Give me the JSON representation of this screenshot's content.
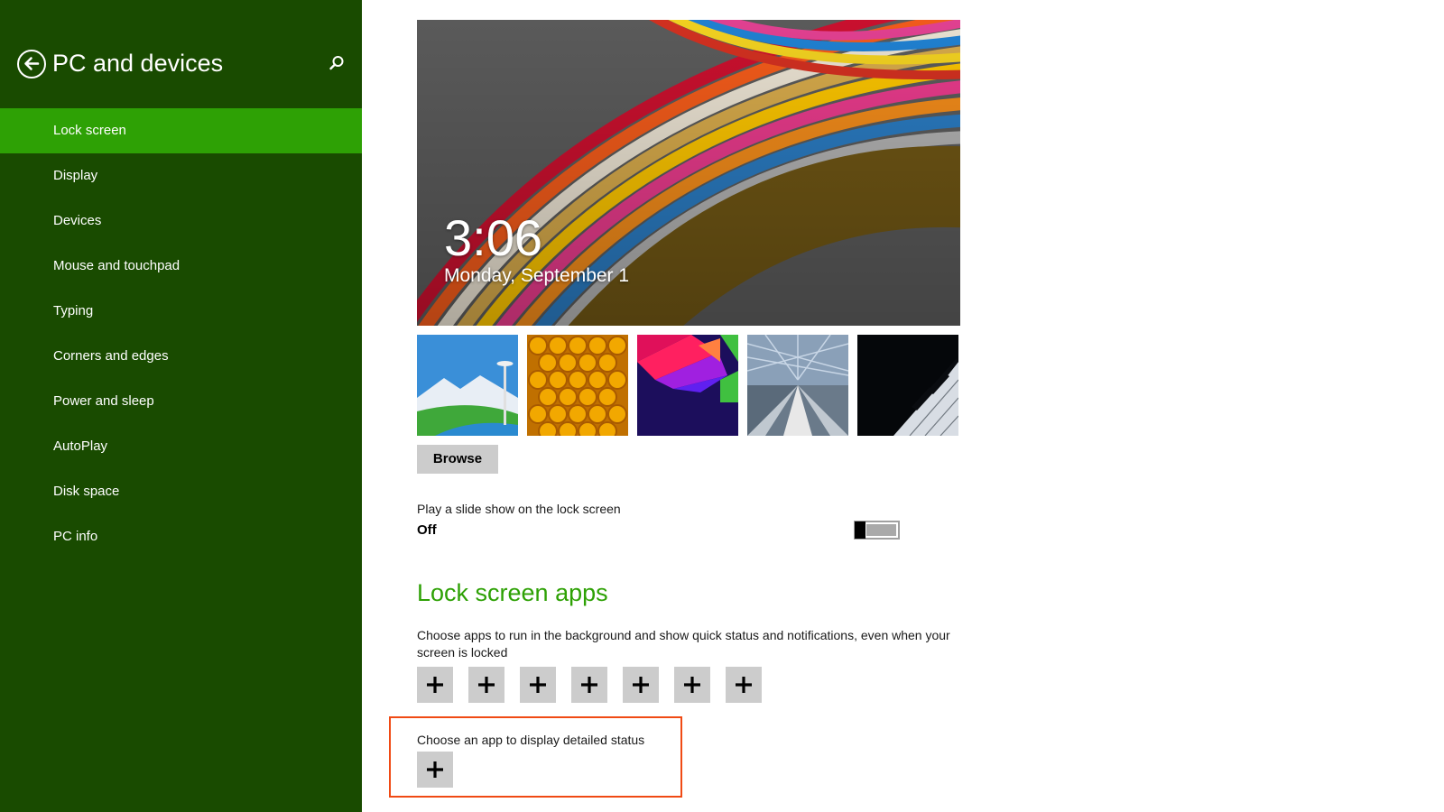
{
  "sidebar": {
    "title": "PC and devices",
    "items": [
      {
        "label": "Lock screen",
        "active": true
      },
      {
        "label": "Display"
      },
      {
        "label": "Devices"
      },
      {
        "label": "Mouse and touchpad"
      },
      {
        "label": "Typing"
      },
      {
        "label": "Corners and edges"
      },
      {
        "label": "Power and sleep"
      },
      {
        "label": "AutoPlay"
      },
      {
        "label": "Disk space"
      },
      {
        "label": "PC info"
      }
    ],
    "icons": {
      "back": "back-arrow-icon",
      "search": "search-icon"
    }
  },
  "preview": {
    "time": "3:06",
    "date": "Monday, September 1"
  },
  "thumbnails": [
    {
      "name": "space-needle"
    },
    {
      "name": "honeycomb"
    },
    {
      "name": "geometric-shapes"
    },
    {
      "name": "subway-motion"
    },
    {
      "name": "piano-keys"
    }
  ],
  "browse_label": "Browse",
  "slideshow": {
    "label": "Play a slide show on the lock screen",
    "state": "Off"
  },
  "lock_apps": {
    "heading": "Lock screen apps",
    "description": "Choose apps to run in the background and show quick status and notifications, even when your screen is locked",
    "slots": 7,
    "add_icon": "plus-icon"
  },
  "detailed_status": {
    "label": "Choose an app to display detailed status"
  },
  "colors": {
    "sidebar_bg": "#194b00",
    "accent": "#2ea105",
    "highlight": "#f04a14",
    "button_bg": "#cccccc"
  }
}
